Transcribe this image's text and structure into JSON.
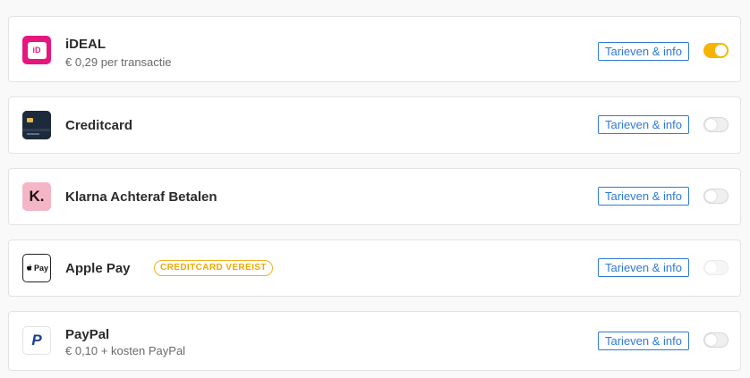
{
  "methods": [
    {
      "title": "iDEAL",
      "subtitle": "€ 0,29 per transactie",
      "info_label": "Tarieven & info",
      "enabled": true,
      "logo_text": "iD"
    },
    {
      "title": "Creditcard",
      "info_label": "Tarieven & info",
      "enabled": false
    },
    {
      "title": "Klarna Achteraf Betalen",
      "info_label": "Tarieven & info",
      "enabled": false,
      "logo_text": "K."
    },
    {
      "title": "Apple Pay",
      "badge": "CREDITCARD VEREIST",
      "info_label": "Tarieven & info",
      "enabled": false,
      "disabled": true,
      "logo_text": "Pay"
    },
    {
      "title": "PayPal",
      "subtitle": "€ 0,10 + kosten PayPal",
      "info_label": "Tarieven & info",
      "enabled": false,
      "logo_text": "P"
    }
  ],
  "colors": {
    "toggle_on": "#f5b500",
    "link_blue": "#2f7ad8",
    "badge_orange": "#f0b21e",
    "ideal_pink": "#e5177f",
    "klarna_pink": "#f4b6c7"
  },
  "icons": {
    "ideal": "ideal-logo-icon",
    "creditcard": "credit-card-icon",
    "klarna": "klarna-logo-icon",
    "applepay": "apple-pay-logo-icon",
    "paypal": "paypal-logo-icon"
  }
}
